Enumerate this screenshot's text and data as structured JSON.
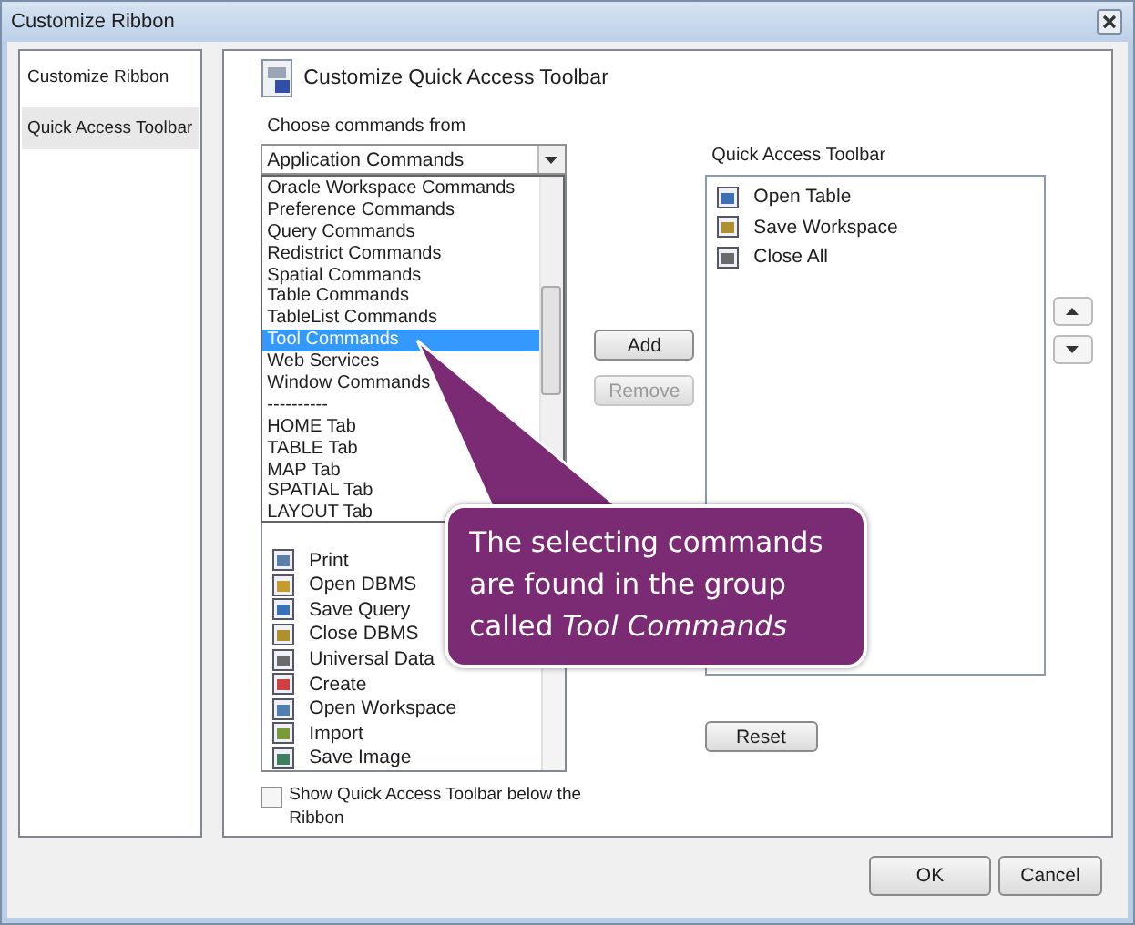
{
  "window": {
    "title": "Customize Ribbon"
  },
  "sidebar": {
    "items": [
      {
        "label": "Customize Ribbon",
        "selected": false
      },
      {
        "label": "Quick Access Toolbar",
        "selected": true
      }
    ]
  },
  "header": {
    "title": "Customize Quick Access Toolbar"
  },
  "choose": {
    "label": "Choose commands from",
    "value": "Application Commands"
  },
  "dropdown": {
    "items": [
      {
        "label": "Oracle Workspace Commands",
        "selected": false
      },
      {
        "label": "Preference Commands",
        "selected": false
      },
      {
        "label": "Query Commands",
        "selected": false
      },
      {
        "label": "Redistrict Commands",
        "selected": false
      },
      {
        "label": "Spatial Commands",
        "selected": false
      },
      {
        "label": "Table Commands",
        "selected": false
      },
      {
        "label": "TableList Commands",
        "selected": false
      },
      {
        "label": "Tool Commands",
        "selected": true
      },
      {
        "label": "Web Services",
        "selected": false
      },
      {
        "label": "Window Commands",
        "selected": false
      },
      {
        "label": "----------",
        "selected": false
      },
      {
        "label": "HOME Tab",
        "selected": false
      },
      {
        "label": "TABLE Tab",
        "selected": false
      },
      {
        "label": "MAP Tab",
        "selected": false
      },
      {
        "label": "SPATIAL Tab",
        "selected": false
      },
      {
        "label": "LAYOUT Tab",
        "selected": false
      }
    ]
  },
  "commands": {
    "items": [
      {
        "label": "Print"
      },
      {
        "label": "Open DBMS"
      },
      {
        "label": "Save Query"
      },
      {
        "label": "Close DBMS"
      },
      {
        "label": "Universal Data"
      },
      {
        "label": "Create"
      },
      {
        "label": "Open Workspace"
      },
      {
        "label": "Import"
      },
      {
        "label": "Save Image"
      }
    ]
  },
  "show_below": {
    "label": "Show Quick Access Toolbar below the Ribbon",
    "checked": false
  },
  "add_button": {
    "label": "Add",
    "disabled": false
  },
  "remove_button": {
    "label": "Remove",
    "disabled": true
  },
  "toolbar_list": {
    "label": "Quick Access Toolbar",
    "items": [
      {
        "label": "Open Table"
      },
      {
        "label": "Save Workspace"
      },
      {
        "label": "Close All"
      }
    ]
  },
  "reset_button": {
    "label": "Reset"
  },
  "footer": {
    "buttons": [
      "OK",
      "Cancel"
    ]
  },
  "callout": {
    "text": "The selecting commands are found in the group called *Tool Commands*"
  }
}
